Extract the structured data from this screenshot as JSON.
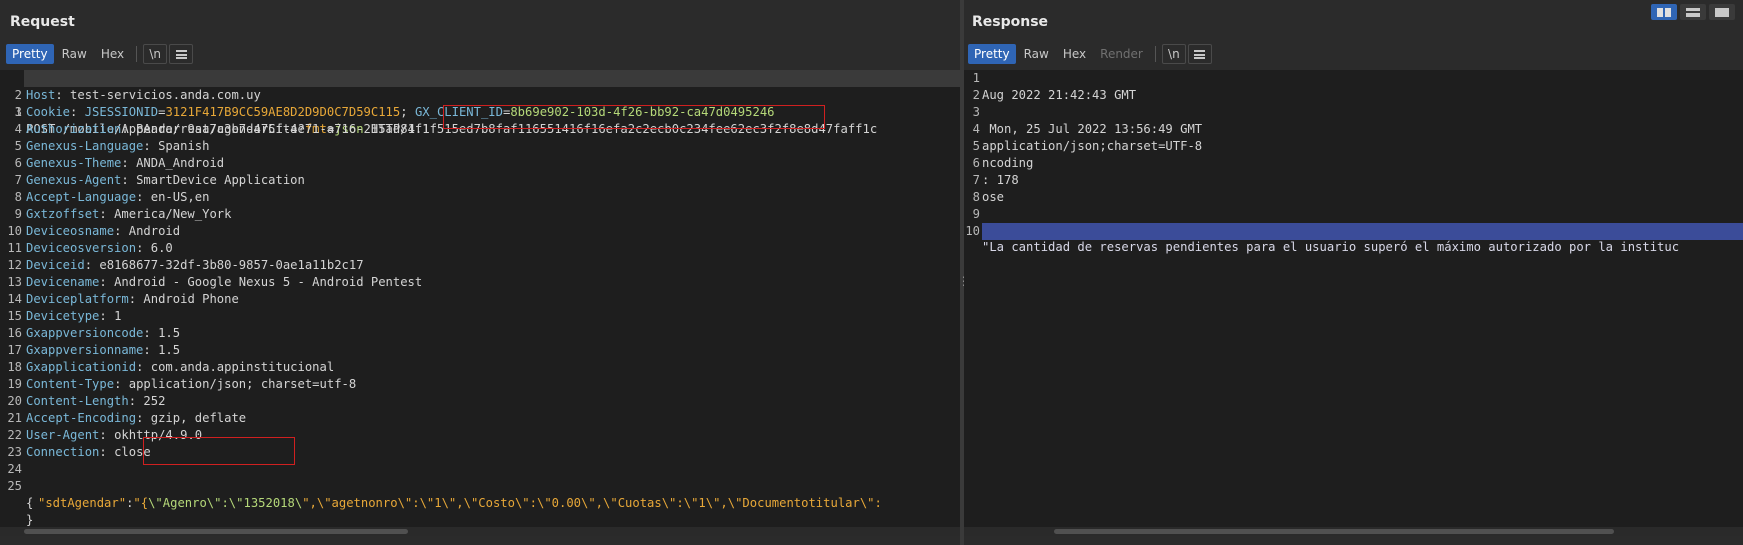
{
  "request": {
    "title": "Request",
    "tabs": [
      "Pretty",
      "Raw",
      "Hex"
    ],
    "newline_label": "\\n",
    "request_line": {
      "method": "POST",
      "path": "/mobile/AppAnda/rest/agendarCita?",
      "param": "fmt",
      "eq": "=",
      "pval": "json",
      "proto": " HTTP/1.1"
    },
    "headers": [
      {
        "n": "Host",
        "v": "test-servicios.anda.com.uy"
      },
      {
        "n": "Cookie",
        "v": ""
      },
      {
        "n": "Authorization",
        "v": "Bearer 9aa7c3b7-475f-4e71-a716-215ad84f1f51"
      },
      {
        "n": "Genexus-Language",
        "v": "Spanish"
      },
      {
        "n": "Genexus-Theme",
        "v": "ANDA_Android"
      },
      {
        "n": "Genexus-Agent",
        "v": "SmartDevice Application"
      },
      {
        "n": "Accept-Language",
        "v": "en-US,en"
      },
      {
        "n": "Gxtzoffset",
        "v": "America/New_York"
      },
      {
        "n": "Deviceosname",
        "v": "Android"
      },
      {
        "n": "Deviceosversion",
        "v": "6.0"
      },
      {
        "n": "Deviceid",
        "v": "e8168677-32df-3b80-9857-0ae1a11b2c17"
      },
      {
        "n": "Devicename",
        "v": "Android - Google Nexus 5 - Android Pentest"
      },
      {
        "n": "Deviceplatform",
        "v": "Android Phone"
      },
      {
        "n": "Devicetype",
        "v": "1"
      },
      {
        "n": "Gxappversioncode",
        "v": "1.5"
      },
      {
        "n": "Gxappversionname",
        "v": "1.5"
      },
      {
        "n": "Gxapplicationid",
        "v": "com.anda.appinstitucional"
      },
      {
        "n": "Content-Type",
        "v": "application/json; charset=utf-8"
      },
      {
        "n": "Content-Length",
        "v": "252"
      },
      {
        "n": "Accept-Encoding",
        "v": "gzip, deflate"
      },
      {
        "n": "User-Agent",
        "v": "okhttp/4.9.0"
      },
      {
        "n": "Connection",
        "v": "close"
      }
    ],
    "cookie": {
      "k1": "JSESSIONID",
      "v1": "3121F417B9CC59AE8D2D9D0C7D59C115",
      "k2": "GX_CLIENT_ID",
      "v2": "8b69e902-103d-4f26-bb92-ca47d0495246"
    },
    "auth_token_highlight": "5ed7b8faf116551416f16efa2c2ecb0c234fee62ec3f2f8e8d47faff1c",
    "body": {
      "open": "{",
      "key": "\"sdtAgendar\"",
      "colon": ":",
      "value_a": "\"{",
      "value_b": "\\\"Agenro\\\":\\\"1352018\\",
      "value_c": "\",\\\"agetnonro\\\":\\\"1\\\",\\\"Costo\\\":\\\"0.00\\\",\\\"Cuotas\\\":\\\"1\\\",\\\"Documentotitular\\\":",
      "close": "}"
    },
    "line_numbers": [
      "1",
      "2",
      "3",
      "4",
      "5",
      "6",
      "7",
      "8",
      "9",
      "10",
      "11",
      "12",
      "13",
      "14",
      "15",
      "16",
      "17",
      "18",
      "19",
      "20",
      "21",
      "22",
      "23",
      "24",
      "25"
    ]
  },
  "response": {
    "title": "Response",
    "tabs": [
      "Pretty",
      "Raw",
      "Hex",
      "Render"
    ],
    "newline_label": "\\n",
    "lines": [
      "",
      "Aug 2022 21:42:43 GMT",
      "",
      " Mon, 25 Jul 2022 13:56:49 GMT",
      "application/json;charset=UTF-8",
      "ncoding",
      ": 178",
      "ose",
      "",
      "",
      "\"La cantidad de reservas pendientes para el usuario superó el máximo autorizado por la instituc"
    ],
    "line_numbers": [
      "1",
      "2",
      "3",
      "4",
      "5",
      "6",
      "7",
      "8",
      "9",
      "10"
    ]
  },
  "layout_buttons": [
    "side-by-side",
    "stacked",
    "single"
  ]
}
